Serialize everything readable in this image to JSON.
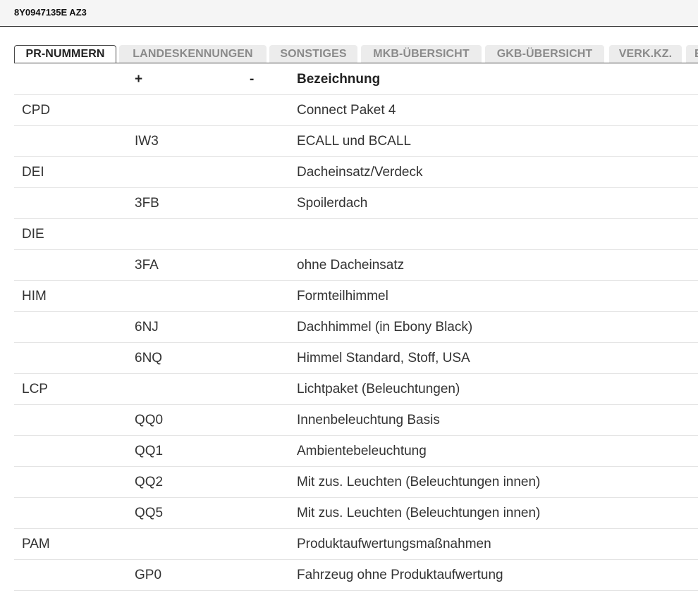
{
  "header": {
    "title": "8Y0947135E AZ3"
  },
  "tabs": [
    {
      "label": "PR-NUMMERN",
      "active": true
    },
    {
      "label": "LANDESKENNUNGEN",
      "active": false
    },
    {
      "label": "SONSTIGES",
      "active": false
    },
    {
      "label": "MKB-ÜBERSICHT",
      "active": false
    },
    {
      "label": "GKB-ÜBERSICHT",
      "active": false
    },
    {
      "label": "VERK.KZ.",
      "active": false
    },
    {
      "label": "E",
      "active": false
    }
  ],
  "table": {
    "columns": [
      "",
      "+",
      "-",
      "Bezeichnung"
    ],
    "rows": [
      [
        "CPD",
        "",
        "",
        "Connect Paket 4"
      ],
      [
        "",
        "IW3",
        "",
        "ECALL und BCALL"
      ],
      [
        "DEI",
        "",
        "",
        "Dacheinsatz/Verdeck"
      ],
      [
        "",
        "3FB",
        "",
        "Spoilerdach"
      ],
      [
        "DIE",
        "",
        "",
        ""
      ],
      [
        "",
        "3FA",
        "",
        "ohne Dacheinsatz"
      ],
      [
        "HIM",
        "",
        "",
        "Formteilhimmel"
      ],
      [
        "",
        "6NJ",
        "",
        "Dachhimmel (in Ebony Black)"
      ],
      [
        "",
        "6NQ",
        "",
        "Himmel Standard, Stoff, USA"
      ],
      [
        "LCP",
        "",
        "",
        "Lichtpaket (Beleuchtungen)"
      ],
      [
        "",
        "QQ0",
        "",
        "Innenbeleuchtung Basis"
      ],
      [
        "",
        "QQ1",
        "",
        "Ambientebeleuchtung"
      ],
      [
        "",
        "QQ2",
        "",
        "Mit zus. Leuchten (Beleuchtungen innen)"
      ],
      [
        "",
        "QQ5",
        "",
        "Mit zus. Leuchten (Beleuchtungen innen)"
      ],
      [
        "PAM",
        "",
        "",
        "Produktaufwertungsmaßnahmen"
      ],
      [
        "",
        "GP0",
        "",
        "Fahrzeug ohne Produktaufwertung"
      ]
    ]
  }
}
